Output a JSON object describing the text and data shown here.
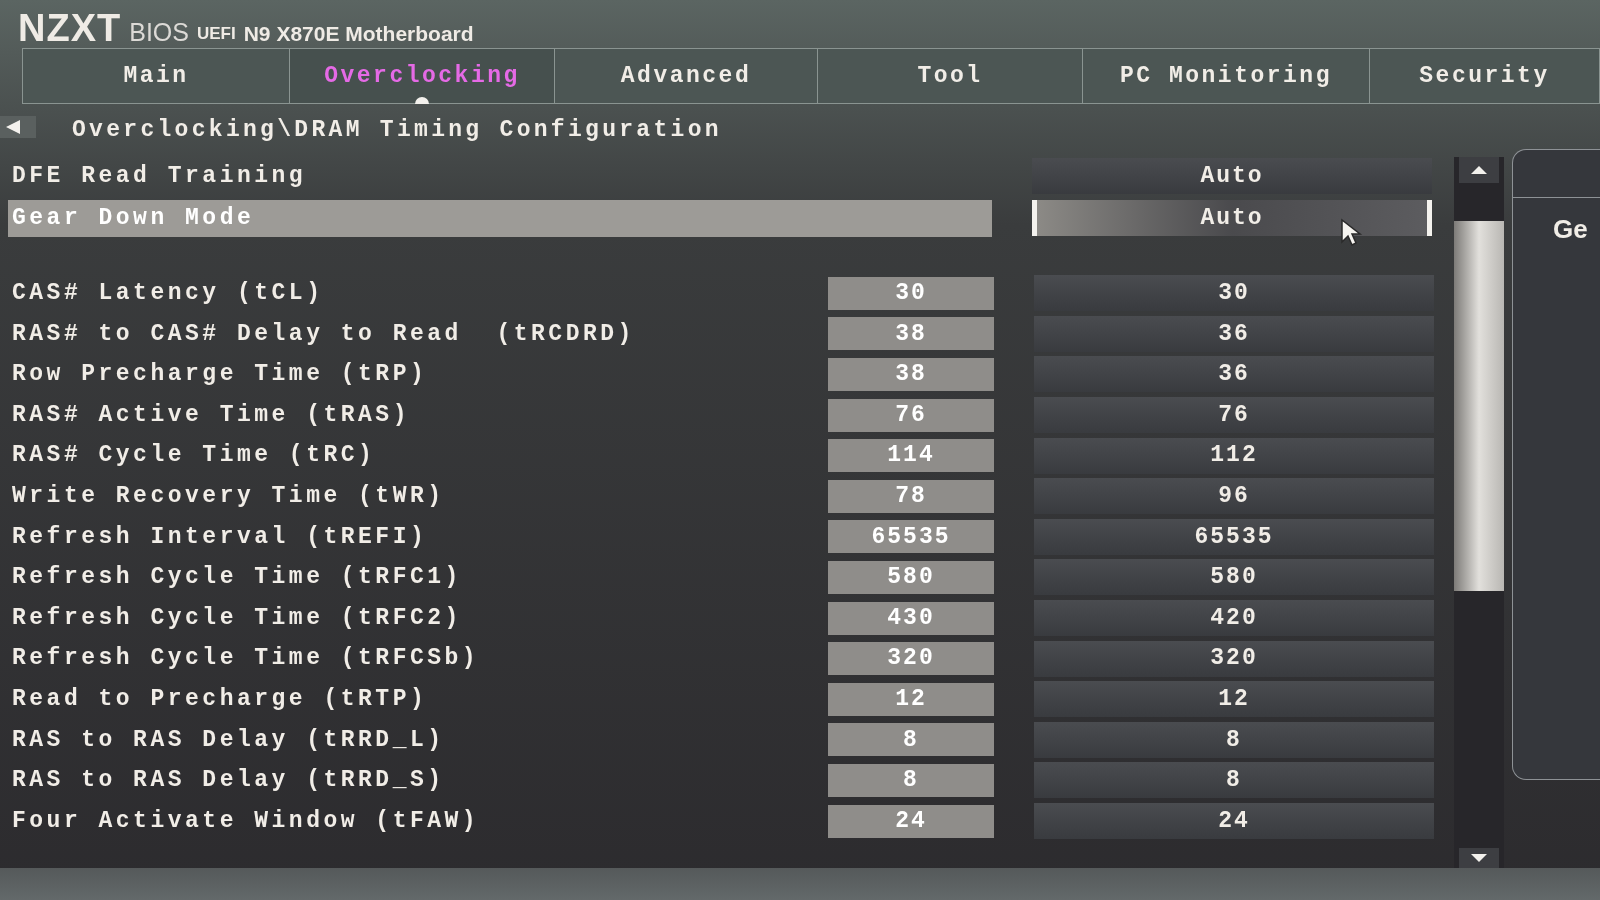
{
  "header": {
    "logo": "NZXT",
    "product": "BIOS",
    "firmware": "UEFI",
    "board": "N9 X870E Motherboard"
  },
  "tabs": [
    {
      "label": "Main",
      "selected": false
    },
    {
      "label": "Overclocking",
      "selected": true
    },
    {
      "label": "Advanced",
      "selected": false
    },
    {
      "label": "Tool",
      "selected": false
    },
    {
      "label": "PC Monitoring",
      "selected": false
    },
    {
      "label": "Security",
      "selected": false
    }
  ],
  "breadcrumb": {
    "path": "Overclocking\\DRAM Timing Configuration"
  },
  "settings": [
    {
      "kind": "option",
      "label": "DFE Read Training",
      "value": "Auto",
      "selected": false
    },
    {
      "kind": "option",
      "label": "Gear Down Mode",
      "value": "Auto",
      "selected": true
    },
    {
      "kind": "timing",
      "label": "CAS# Latency (tCL)",
      "current": "30",
      "value": "30",
      "selected": false
    },
    {
      "kind": "timing",
      "label": "RAS# to CAS# Delay to Read  (tRCDRD)",
      "current": "38",
      "value": "36",
      "selected": false
    },
    {
      "kind": "timing",
      "label": "Row Precharge Time (tRP)",
      "current": "38",
      "value": "36",
      "selected": false
    },
    {
      "kind": "timing",
      "label": "RAS# Active Time (tRAS)",
      "current": "76",
      "value": "76",
      "selected": false
    },
    {
      "kind": "timing",
      "label": "RAS# Cycle Time (tRC)",
      "current": "114",
      "value": "112",
      "selected": false
    },
    {
      "kind": "timing",
      "label": "Write Recovery Time (tWR)",
      "current": "78",
      "value": "96",
      "selected": false
    },
    {
      "kind": "timing",
      "label": "Refresh Interval (tREFI)",
      "current": "65535",
      "value": "65535",
      "selected": false
    },
    {
      "kind": "timing",
      "label": "Refresh Cycle Time (tRFC1)",
      "current": "580",
      "value": "580",
      "selected": false
    },
    {
      "kind": "timing",
      "label": "Refresh Cycle Time (tRFC2)",
      "current": "430",
      "value": "420",
      "selected": false
    },
    {
      "kind": "timing",
      "label": "Refresh Cycle Time (tRFCSb)",
      "current": "320",
      "value": "320",
      "selected": false
    },
    {
      "kind": "timing",
      "label": "Read to Precharge (tRTP)",
      "current": "12",
      "value": "12",
      "selected": false
    },
    {
      "kind": "timing",
      "label": "RAS to RAS Delay (tRRD_L)",
      "current": "8",
      "value": "8",
      "selected": false
    },
    {
      "kind": "timing",
      "label": "RAS to RAS Delay (tRRD_S)",
      "current": "8",
      "value": "8",
      "selected": false
    },
    {
      "kind": "timing",
      "label": "Four Activate Window (tFAW)",
      "current": "24",
      "value": "24",
      "selected": false
    }
  ],
  "help_panel": {
    "title": "Ge"
  }
}
